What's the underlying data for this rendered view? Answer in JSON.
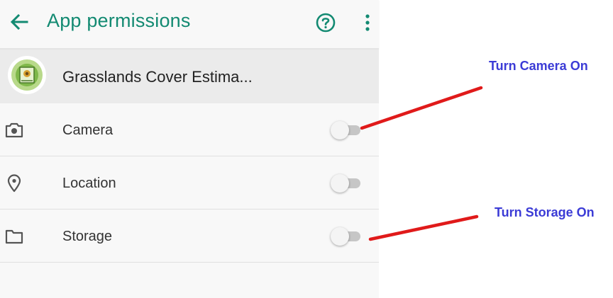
{
  "appbar": {
    "title": "App permissions",
    "back_icon": "arrow-left-icon",
    "help_icon": "help-circle-icon",
    "more_icon": "more-vert-icon"
  },
  "app": {
    "name": "Grasslands Cover Estima...",
    "logo_icon": "app-logo-icon"
  },
  "permissions": [
    {
      "label": "Camera",
      "icon": "camera-icon",
      "enabled": false
    },
    {
      "label": "Location",
      "icon": "location-pin-icon",
      "enabled": false
    },
    {
      "label": "Storage",
      "icon": "folder-icon",
      "enabled": false
    }
  ],
  "annotations": [
    {
      "text": "Turn Camera On"
    },
    {
      "text": "Turn Storage On"
    }
  ],
  "colors": {
    "accent": "#138a72",
    "annotation_text": "#3b3bd6",
    "annotation_line": "#e01a1a"
  }
}
